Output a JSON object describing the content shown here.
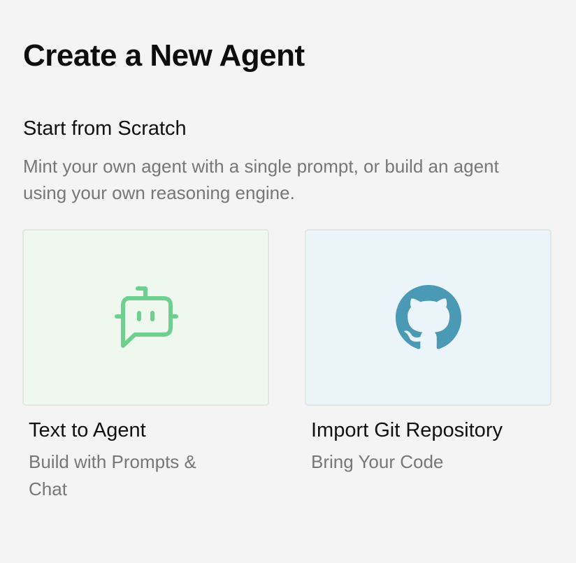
{
  "page": {
    "title": "Create a New Agent"
  },
  "section": {
    "title": "Start from Scratch",
    "description": "Mint your own agent with a single prompt, or build an agent using your own reasoning engine."
  },
  "options": [
    {
      "label": "Text to Agent",
      "subtitle": "Build with Prompts & Chat",
      "icon": "bot-chat-icon",
      "card_color": "#eff8ee",
      "icon_color": "#6fcf8f"
    },
    {
      "label": "Import Git Repository",
      "subtitle": "Bring Your Code",
      "icon": "github-icon",
      "card_color": "#ebf4f8",
      "icon_color": "#4a9ab5"
    }
  ]
}
